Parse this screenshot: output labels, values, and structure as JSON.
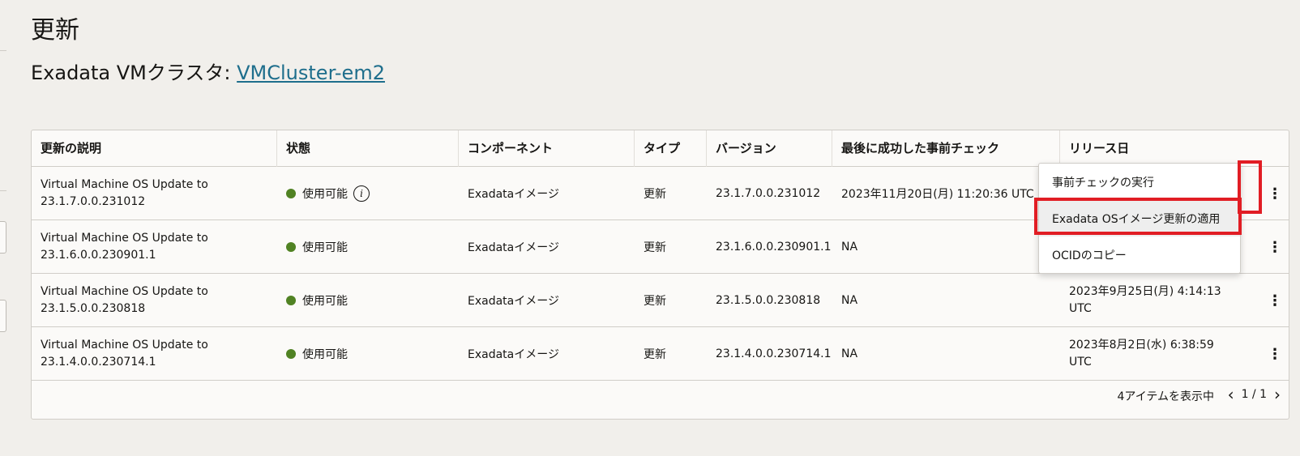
{
  "page": {
    "title": "更新",
    "subtitle_prefix": "Exadata VMクラスタ: ",
    "subtitle_link": "VMCluster-em2"
  },
  "table": {
    "columns": [
      "更新の説明",
      "状態",
      "コンポーネント",
      "タイプ",
      "バージョン",
      "最後に成功した事前チェック",
      "リリース日"
    ],
    "rows": [
      {
        "description_line1": "Virtual Machine OS Update to",
        "description_line2": "23.1.7.0.0.231012",
        "status": "使用可能",
        "status_has_info": true,
        "component": "Exadataイメージ",
        "type": "更新",
        "version": "23.1.7.0.0.231012",
        "last_precheck": "2023年11月20日(月) 11:20:36 UTC",
        "release_line1": "",
        "release_line2": ""
      },
      {
        "description_line1": "Virtual Machine OS Update to",
        "description_line2": "23.1.6.0.0.230901.1",
        "status": "使用可能",
        "status_has_info": false,
        "component": "Exadataイメージ",
        "type": "更新",
        "version": "23.1.6.0.0.230901.1",
        "last_precheck": "NA",
        "release_line1": "",
        "release_line2": ""
      },
      {
        "description_line1": "Virtual Machine OS Update to",
        "description_line2": "23.1.5.0.0.230818",
        "status": "使用可能",
        "status_has_info": false,
        "component": "Exadataイメージ",
        "type": "更新",
        "version": "23.1.5.0.0.230818",
        "last_precheck": "NA",
        "release_line1": "2023年9月25日(月) 4:14:13",
        "release_line2": "UTC"
      },
      {
        "description_line1": "Virtual Machine OS Update to",
        "description_line2": "23.1.4.0.0.230714.1",
        "status": "使用可能",
        "status_has_info": false,
        "component": "Exadataイメージ",
        "type": "更新",
        "version": "23.1.4.0.0.230714.1",
        "last_precheck": "NA",
        "release_line1": "2023年8月2日(水) 6:38:59",
        "release_line2": "UTC"
      }
    ],
    "footer_count": "4アイテムを表示中",
    "pagination": "1 / 1"
  },
  "menu": {
    "items": [
      "事前チェックの実行",
      "Exadata OSイメージ更新の適用",
      "OCIDのコピー"
    ]
  },
  "colors": {
    "status_available": "#508223",
    "link": "#1e6e8c",
    "highlight": "#e11d24"
  }
}
